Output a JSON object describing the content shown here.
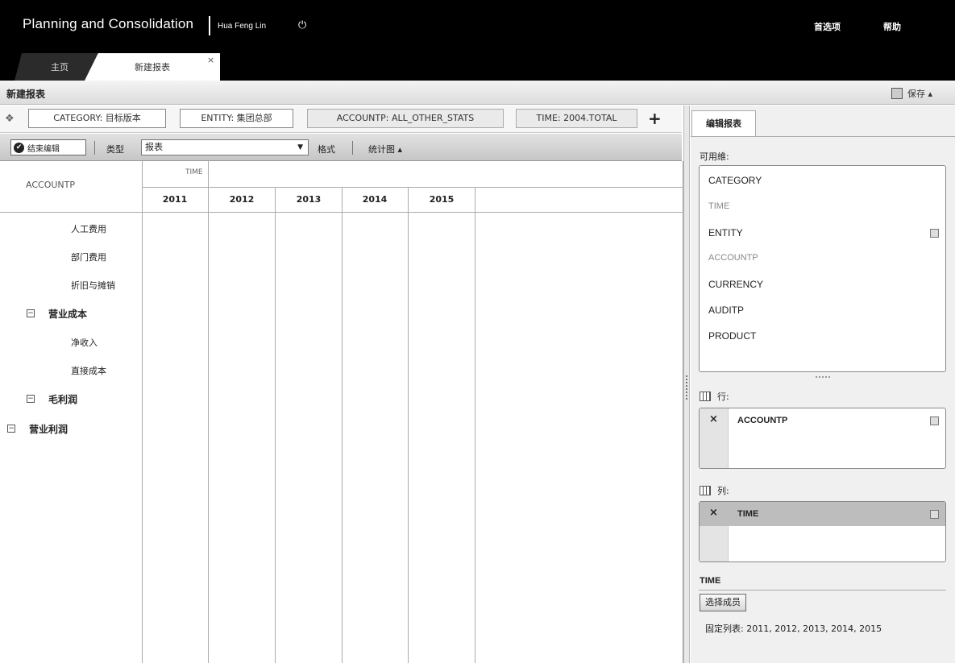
{
  "header": {
    "app_title": "Planning and Consolidation",
    "user_name": "Hua Feng Lin",
    "power_icon": "power-icon",
    "preferences": "首选项",
    "help": "帮助"
  },
  "tabs": [
    {
      "label": "主页"
    },
    {
      "label": "新建报表"
    }
  ],
  "tab_close": "×",
  "page": {
    "title": "新建报表",
    "save_label": "保存 ▴"
  },
  "filters": [
    {
      "label": "CATEGORY: 目标版本"
    },
    {
      "label": "ENTITY: 集团总部"
    },
    {
      "label": "ACCOUNTP: ALL_OTHER_STATS"
    },
    {
      "label": "TIME: 2004.TOTAL"
    }
  ],
  "filter_add": "+",
  "toolbar": {
    "end_edit": "结束编辑",
    "type_label": "类型",
    "type_value": "报表",
    "format": "格式",
    "chart": "统计图 ▴"
  },
  "grid": {
    "row_dimension": "ACCOUNTP",
    "column_dimension": "TIME",
    "years": [
      "2011",
      "2012",
      "2013",
      "2014",
      "2015"
    ],
    "rows": [
      {
        "label": "人工费用"
      },
      {
        "label": "部门费用"
      },
      {
        "label": "折旧与摊销"
      },
      {
        "label": "营业成本",
        "toggle": "⊟"
      },
      {
        "label": "净收入"
      },
      {
        "label": "直接成本"
      },
      {
        "label": "毛利润",
        "toggle": "⊟"
      },
      {
        "label": "营业利润",
        "toggle": "⊟"
      }
    ]
  },
  "panel": {
    "tab": "编辑报表",
    "available_label": "可用維:",
    "dimensions": [
      {
        "name": "CATEGORY",
        "enabled": true
      },
      {
        "name": "TIME",
        "enabled": false
      },
      {
        "name": "ENTITY",
        "enabled": true
      },
      {
        "name": "ACCOUNTP",
        "enabled": false
      },
      {
        "name": "CURRENCY",
        "enabled": true
      },
      {
        "name": "AUDITP",
        "enabled": true
      },
      {
        "name": "PRODUCT",
        "enabled": true
      }
    ],
    "rows_label": "行:",
    "rows_item": "ACCOUNTP",
    "cols_label": "列:",
    "cols_item": "TIME",
    "remove_icon": "×",
    "time_section": "TIME",
    "select_members": "选择成员",
    "fixed_list": "固定列表: 2011, 2012, 2013, 2014, 2015"
  }
}
